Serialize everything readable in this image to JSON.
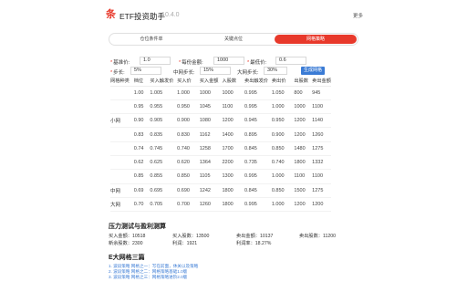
{
  "header": {
    "logo_glyph": "条",
    "title": "ETF投资助手",
    "version": "0.4.0",
    "more_label": "更多"
  },
  "tabs": [
    {
      "label": "仓位条件单",
      "active": false
    },
    {
      "label": "关键点位",
      "active": false
    },
    {
      "label": "网格策略",
      "active": true
    }
  ],
  "form": {
    "base_price": {
      "label": "基准价",
      "value": "1.0"
    },
    "per_amount": {
      "label": "每份金额",
      "value": "1000"
    },
    "lowest_price": {
      "label": "最低价",
      "value": "0.6"
    },
    "step": {
      "label": "步长",
      "value": "5%"
    },
    "mid_step": {
      "label": "中网步长",
      "value": "15%"
    },
    "big_step": {
      "label": "大网步长",
      "value": "30%"
    },
    "generate_label": "生成网格"
  },
  "grid": {
    "headers": [
      "网格种类",
      "档位",
      "买入触发价",
      "买入价",
      "买入金额",
      "入股数",
      "卖出触发价",
      "卖出价",
      "出股数",
      "卖出金额"
    ],
    "rows": [
      [
        "",
        "1.00",
        "1.005",
        "1.000",
        "1000",
        "1000",
        "0.995",
        "1.050",
        "800",
        "945"
      ],
      [
        "",
        "0.95",
        "0.955",
        "0.950",
        "1045",
        "1100",
        "0.995",
        "1.000",
        "1000",
        "1100"
      ],
      [
        "小网",
        "0.90",
        "0.905",
        "0.900",
        "1080",
        "1200",
        "0.945",
        "0.950",
        "1200",
        "1140"
      ],
      [
        "",
        "0.83",
        "0.835",
        "0.830",
        "1162",
        "1400",
        "0.895",
        "0.900",
        "1200",
        "1260"
      ],
      [
        "",
        "0.74",
        "0.745",
        "0.740",
        "1258",
        "1700",
        "0.845",
        "0.850",
        "1480",
        "1275"
      ],
      [
        "",
        "0.62",
        "0.625",
        "0.620",
        "1364",
        "2200",
        "0.735",
        "0.740",
        "1800",
        "1332"
      ],
      [
        "",
        "0.85",
        "0.855",
        "0.850",
        "1105",
        "1300",
        "0.995",
        "1.000",
        "1100",
        "1100"
      ],
      [
        "中网",
        "0.69",
        "0.695",
        "0.690",
        "1242",
        "1800",
        "0.845",
        "0.850",
        "1500",
        "1275"
      ],
      [
        "大网",
        "0.70",
        "0.705",
        "0.700",
        "1260",
        "1800",
        "0.995",
        "1.000",
        "1200",
        "1200"
      ]
    ]
  },
  "stats": {
    "title": "压力测试与盈利测算",
    "buy_amount_label": "买入金额：",
    "buy_amount": "10518",
    "buy_shares_label": "买入股数：",
    "buy_shares": "13500",
    "sell_amount_label": "卖出金额：",
    "sell_amount": "10137",
    "sell_shares_label": "卖出股数：",
    "sell_shares": "11200",
    "new_shares_label": "新余股数：",
    "new_shares": "2300",
    "profit_label": "利润：",
    "profit": "1921",
    "profit_rate_label": "利润率：",
    "profit_rate": "18.27%"
  },
  "articles": {
    "title": "E大网格三篇",
    "links": [
      "1. 波段策略 网格之一：写在前面，休关以及策略",
      "2. 波段策略 网格之二：网格策略基础1.0版",
      "3. 波段策略 网格之三：网格策略进阶2.0版"
    ]
  }
}
